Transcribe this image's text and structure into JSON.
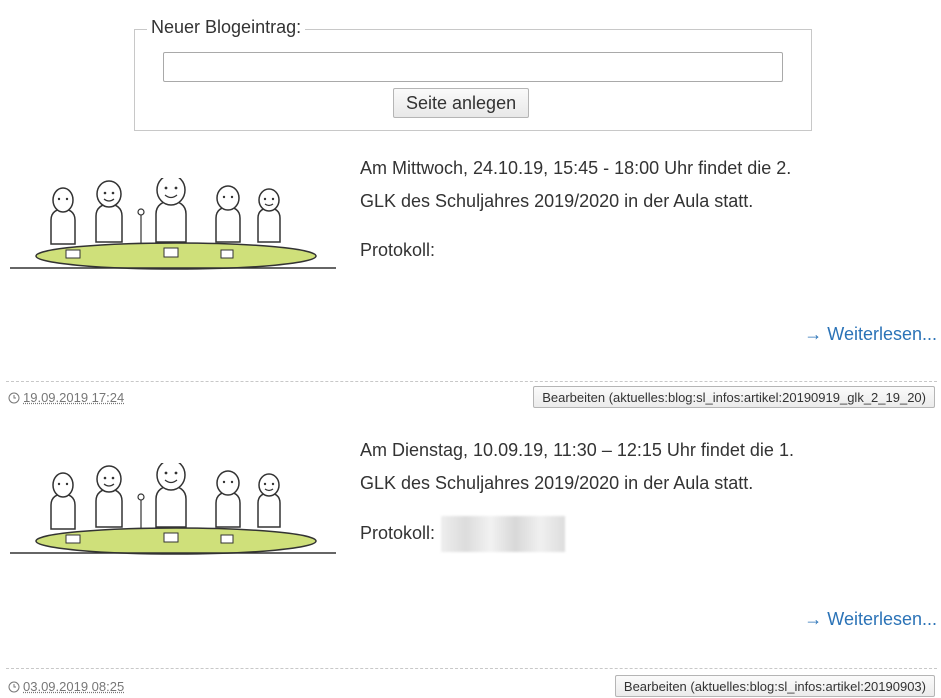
{
  "new_entry": {
    "legend": "Neuer Blogeintrag:",
    "input_value": "",
    "button_label": "Seite anlegen"
  },
  "entries": [
    {
      "line1": "Am Mittwoch, 24.10.19, 15:45 - 18:00 Uhr findet die 2.",
      "line2": "GLK des Schuljahres 2019/2020 in der Aula statt.",
      "protokoll_label": "Protokoll:",
      "read_more": "→ Weiterlesen...",
      "date": "19.09.2019 17:24",
      "edit_label": "Bearbeiten (aktuelles:blog:sl_infos:artikel:20190919_glk_2_19_20)"
    },
    {
      "line1": "Am Dienstag, 10.09.19, 11:30 – 12:15 Uhr findet die 1.",
      "line2": "GLK des Schuljahres 2019/2020 in der Aula statt.",
      "protokoll_label": "Protokoll:",
      "read_more": "→ Weiterlesen...",
      "date": "03.09.2019 08:25",
      "edit_label": "Bearbeiten (aktuelles:blog:sl_infos:artikel:20190903)"
    }
  ],
  "colors": {
    "link": "#2b73b7",
    "table": "#cfe07a",
    "border": "#c8c8c8"
  }
}
